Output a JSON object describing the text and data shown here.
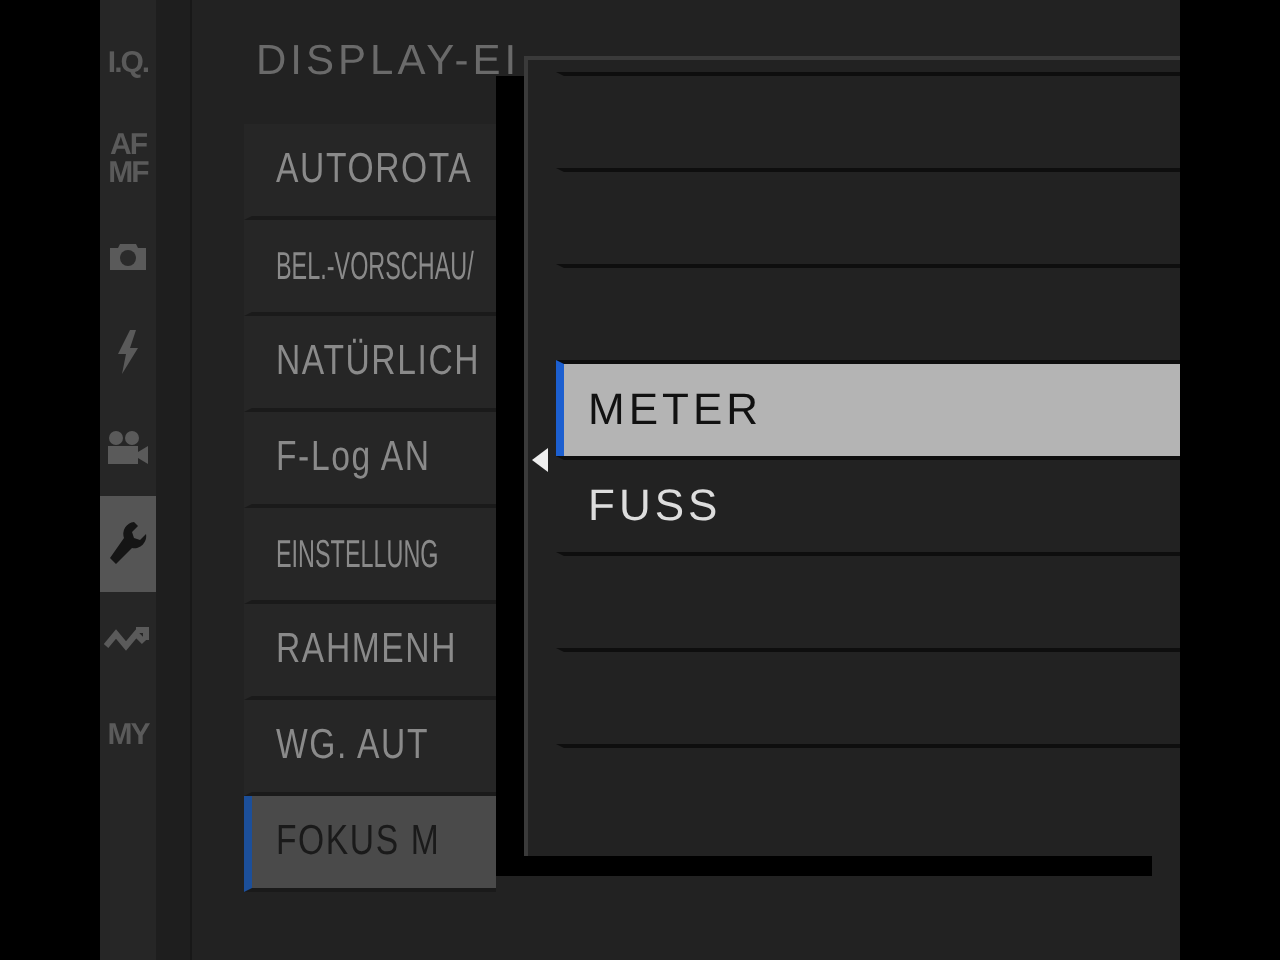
{
  "sidebar": {
    "items": [
      {
        "kind": "text",
        "label": "I.Q.",
        "selected": false
      },
      {
        "kind": "text",
        "label": "AF MF",
        "selected": false
      },
      {
        "kind": "camera",
        "selected": false
      },
      {
        "kind": "flash",
        "selected": false
      },
      {
        "kind": "video",
        "selected": false
      },
      {
        "kind": "wrench",
        "selected": true
      },
      {
        "kind": "wave",
        "selected": false
      },
      {
        "kind": "text",
        "label": "MY",
        "selected": false
      }
    ]
  },
  "menu": {
    "title": "DISPLAY-EI",
    "items": [
      {
        "label": "AUTOROTA",
        "kind": "normal",
        "selected": false
      },
      {
        "label": "BEL.-VORSCHAU/",
        "kind": "small",
        "selected": false
      },
      {
        "label": "NATÜRLICH",
        "kind": "normal",
        "selected": false
      },
      {
        "label": "F-Log AN",
        "kind": "normal",
        "selected": false
      },
      {
        "label": "EINSTELLUNG",
        "kind": "small",
        "selected": false
      },
      {
        "label": "RAHMENH",
        "kind": "normal",
        "selected": false
      },
      {
        "label": "WG. AUT",
        "kind": "normal",
        "selected": false
      },
      {
        "label": "FOKUS M",
        "kind": "normal",
        "selected": true
      }
    ]
  },
  "popup": {
    "options": [
      {
        "selected": false
      },
      {
        "selected": false
      },
      {
        "selected": false
      },
      {
        "label": "METER",
        "selected": true
      },
      {
        "label": "FUSS",
        "selected": false
      },
      {
        "selected": false
      },
      {
        "selected": false
      },
      {
        "selected": false
      }
    ]
  }
}
